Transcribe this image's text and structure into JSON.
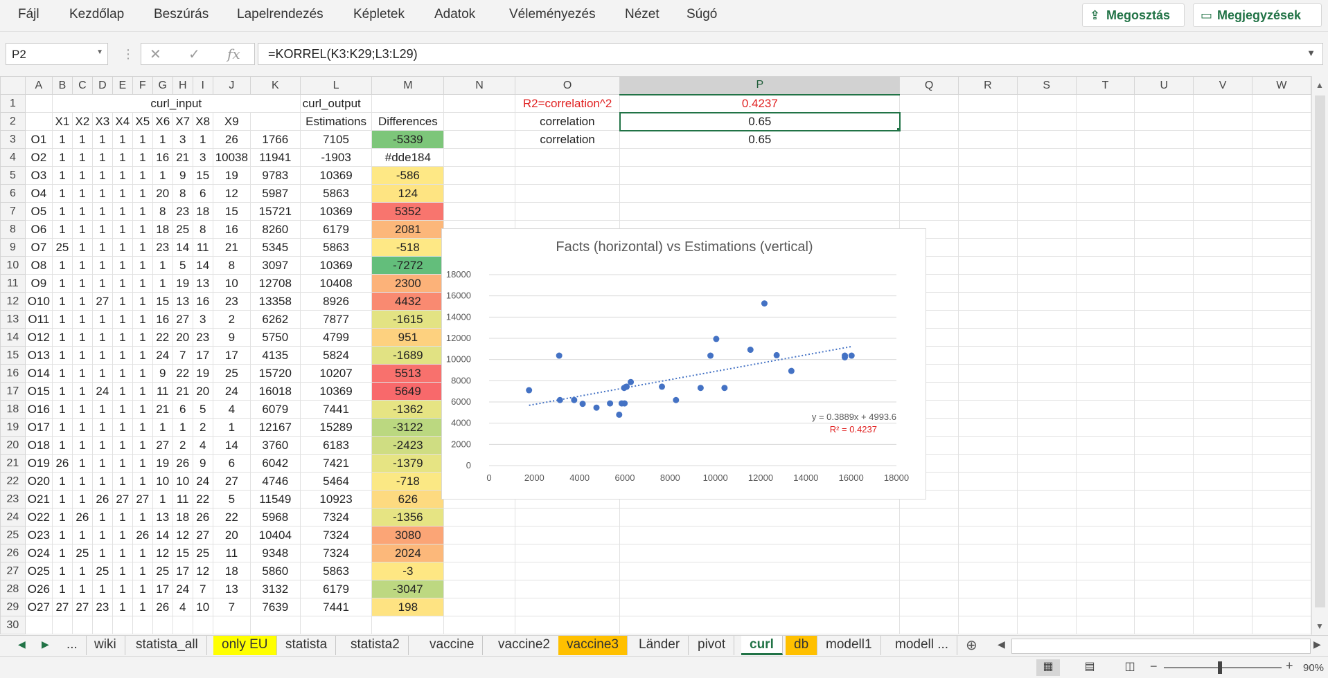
{
  "menu": [
    "Fájl",
    "Kezdőlap",
    "Beszúrás",
    "Lapelrendezés",
    "Képletek",
    "Adatok",
    "Véleményezés",
    "Nézet",
    "Súgó"
  ],
  "share_label": "Megosztás",
  "comments_label": "Megjegyzések",
  "name_box": "P2",
  "formula": "=KORREL(K3:K29;L3:L29)",
  "columns": [
    "A",
    "B",
    "C",
    "D",
    "E",
    "F",
    "G",
    "H",
    "I",
    "J",
    "K",
    "L",
    "M",
    "N",
    "O",
    "P",
    "Q",
    "R",
    "S",
    "T",
    "U",
    "V",
    "W"
  ],
  "selected_column": "P",
  "header_row1": {
    "curl_input": "curl_input",
    "curl_output": "curl_output",
    "O": "R2=correlation^2",
    "P": "0.4237"
  },
  "header_row2": {
    "xs": [
      "X1",
      "X2",
      "X3",
      "X4",
      "X5",
      "X6",
      "X7",
      "X8",
      "X9"
    ],
    "L": "Estimations",
    "M": "Differences",
    "O": "correlation",
    "P": "0.65"
  },
  "row3_extra": {
    "O": "correlation",
    "P": "0.65"
  },
  "rows": [
    [
      "O1",
      1,
      1,
      1,
      1,
      1,
      1,
      3,
      1,
      26,
      1766,
      7105,
      -5339,
      "#7dc67a"
    ],
    [
      "O2",
      1,
      1,
      1,
      1,
      1,
      16,
      21,
      3,
      10038,
      11941,
      -1903,
      "#dde184"
    ],
    [
      "O3",
      1,
      1,
      1,
      1,
      1,
      1,
      9,
      15,
      19,
      9783,
      10369,
      -586,
      "#fee885"
    ],
    [
      "O4",
      1,
      1,
      1,
      1,
      1,
      20,
      8,
      6,
      12,
      5987,
      5863,
      124,
      "#fee482"
    ],
    [
      "O5",
      1,
      1,
      1,
      1,
      1,
      8,
      23,
      18,
      15,
      15721,
      10369,
      5352,
      "#f8756e"
    ],
    [
      "O6",
      1,
      1,
      1,
      1,
      1,
      18,
      25,
      8,
      16,
      8260,
      6179,
      2081,
      "#fcb77a"
    ],
    [
      "O7",
      25,
      1,
      1,
      1,
      1,
      23,
      14,
      11,
      21,
      5345,
      5863,
      -518,
      "#fee885"
    ],
    [
      "O8",
      1,
      1,
      1,
      1,
      1,
      1,
      5,
      14,
      8,
      3097,
      10369,
      -7272,
      "#63be7b"
    ],
    [
      "O9",
      1,
      1,
      1,
      1,
      1,
      1,
      19,
      13,
      10,
      12708,
      10408,
      2300,
      "#fcb279"
    ],
    [
      "O10",
      1,
      1,
      27,
      1,
      1,
      15,
      13,
      16,
      23,
      13358,
      8926,
      4432,
      "#f98a71"
    ],
    [
      "O11",
      1,
      1,
      1,
      1,
      1,
      16,
      27,
      3,
      2,
      6262,
      7877,
      -1615,
      "#e3e383"
    ],
    [
      "O12",
      1,
      1,
      1,
      1,
      1,
      22,
      20,
      23,
      9,
      5750,
      4799,
      951,
      "#fdd17f"
    ],
    [
      "O13",
      1,
      1,
      1,
      1,
      1,
      24,
      7,
      17,
      17,
      4135,
      5824,
      -1689,
      "#e1e283"
    ],
    [
      "O14",
      1,
      1,
      1,
      1,
      1,
      9,
      22,
      19,
      25,
      15720,
      10207,
      5513,
      "#f8716d"
    ],
    [
      "O15",
      1,
      1,
      24,
      1,
      1,
      11,
      21,
      20,
      24,
      16018,
      10369,
      5649,
      "#f8696b"
    ],
    [
      "O16",
      1,
      1,
      1,
      1,
      1,
      21,
      6,
      5,
      4,
      6079,
      7441,
      -1362,
      "#e6e483"
    ],
    [
      "O17",
      1,
      1,
      1,
      1,
      1,
      1,
      1,
      2,
      1,
      12167,
      15289,
      -3122,
      "#bbd880"
    ],
    [
      "O18",
      1,
      1,
      1,
      1,
      1,
      27,
      2,
      4,
      14,
      3760,
      6183,
      -2423,
      "#cfdd82"
    ],
    [
      "O19",
      26,
      1,
      1,
      1,
      1,
      19,
      26,
      9,
      6,
      6042,
      7421,
      -1379,
      "#e6e483"
    ],
    [
      "O20",
      1,
      1,
      1,
      1,
      1,
      10,
      10,
      24,
      27,
      4746,
      5464,
      -718,
      "#fbe884"
    ],
    [
      "O21",
      1,
      1,
      26,
      27,
      27,
      1,
      11,
      22,
      5,
      11549,
      10923,
      626,
      "#fdda80"
    ],
    [
      "O22",
      1,
      26,
      1,
      1,
      1,
      13,
      18,
      26,
      22,
      5968,
      7324,
      -1356,
      "#e6e483"
    ],
    [
      "O23",
      1,
      1,
      1,
      1,
      26,
      14,
      12,
      27,
      20,
      10404,
      7324,
      3080,
      "#fba576"
    ],
    [
      "O24",
      1,
      25,
      1,
      1,
      1,
      12,
      15,
      25,
      11,
      9348,
      7324,
      2024,
      "#fcb87a"
    ],
    [
      "O25",
      1,
      1,
      25,
      1,
      1,
      25,
      17,
      12,
      18,
      5860,
      5863,
      -3,
      "#fee783"
    ],
    [
      "O26",
      1,
      1,
      1,
      1,
      1,
      17,
      24,
      7,
      13,
      3132,
      6179,
      -3047,
      "#bdd881"
    ],
    [
      "O27",
      27,
      27,
      23,
      1,
      1,
      26,
      4,
      10,
      7,
      7639,
      7441,
      198,
      "#fee382"
    ]
  ],
  "chart_data": {
    "type": "scatter",
    "title": "Facts (horizontal) vs Estimations (vertical)",
    "xlim": [
      0,
      18000
    ],
    "ylim": [
      0,
      18000
    ],
    "xticks": [
      0,
      2000,
      4000,
      6000,
      8000,
      10000,
      12000,
      14000,
      16000,
      18000
    ],
    "yticks": [
      0,
      2000,
      4000,
      6000,
      8000,
      10000,
      12000,
      14000,
      16000,
      18000
    ],
    "points": [
      [
        1766,
        7105
      ],
      [
        10038,
        11941
      ],
      [
        9783,
        10369
      ],
      [
        5987,
        5863
      ],
      [
        15721,
        10369
      ],
      [
        8260,
        6179
      ],
      [
        5345,
        5863
      ],
      [
        3097,
        10369
      ],
      [
        12708,
        10408
      ],
      [
        13358,
        8926
      ],
      [
        6262,
        7877
      ],
      [
        5750,
        4799
      ],
      [
        4135,
        5824
      ],
      [
        15720,
        10207
      ],
      [
        16018,
        10369
      ],
      [
        6079,
        7441
      ],
      [
        12167,
        15289
      ],
      [
        3760,
        6183
      ],
      [
        6042,
        7421
      ],
      [
        4746,
        5464
      ],
      [
        11549,
        10923
      ],
      [
        5968,
        7324
      ],
      [
        10404,
        7324
      ],
      [
        9348,
        7324
      ],
      [
        5860,
        5863
      ],
      [
        3132,
        6179
      ],
      [
        7639,
        7441
      ]
    ],
    "trendline": {
      "slope": 0.3889,
      "intercept": 4993.6,
      "x_range": [
        1766,
        16018
      ]
    },
    "equation_label": "y = 0.3889x + 4993.6",
    "r2_label": "R² = 0.4237",
    "point_color": "#4472c4",
    "r2_color": "#e02020"
  },
  "sheet_tabs": [
    {
      "label": "...",
      "bg": ""
    },
    {
      "label": "wiki",
      "bg": ""
    },
    {
      "label": "statista_all",
      "bg": ""
    },
    {
      "label": "only EU",
      "bg": "#ffff00"
    },
    {
      "label": "statista",
      "bg": ""
    },
    {
      "label": "statista2",
      "bg": ""
    },
    {
      "label": "vaccine",
      "bg": ""
    },
    {
      "label": "vaccine2",
      "bg": ""
    },
    {
      "label": "vaccine3",
      "bg": "#ffc000"
    },
    {
      "label": "Länder",
      "bg": ""
    },
    {
      "label": "pivot",
      "bg": ""
    },
    {
      "label": "curl",
      "bg": "",
      "active": true
    },
    {
      "label": "db",
      "bg": "#ffc000"
    },
    {
      "label": "modell1",
      "bg": ""
    },
    {
      "label": "modell ...",
      "bg": ""
    }
  ],
  "zoom": "90%",
  "colors": {
    "accent": "#217346",
    "red_text": "#e02020"
  }
}
